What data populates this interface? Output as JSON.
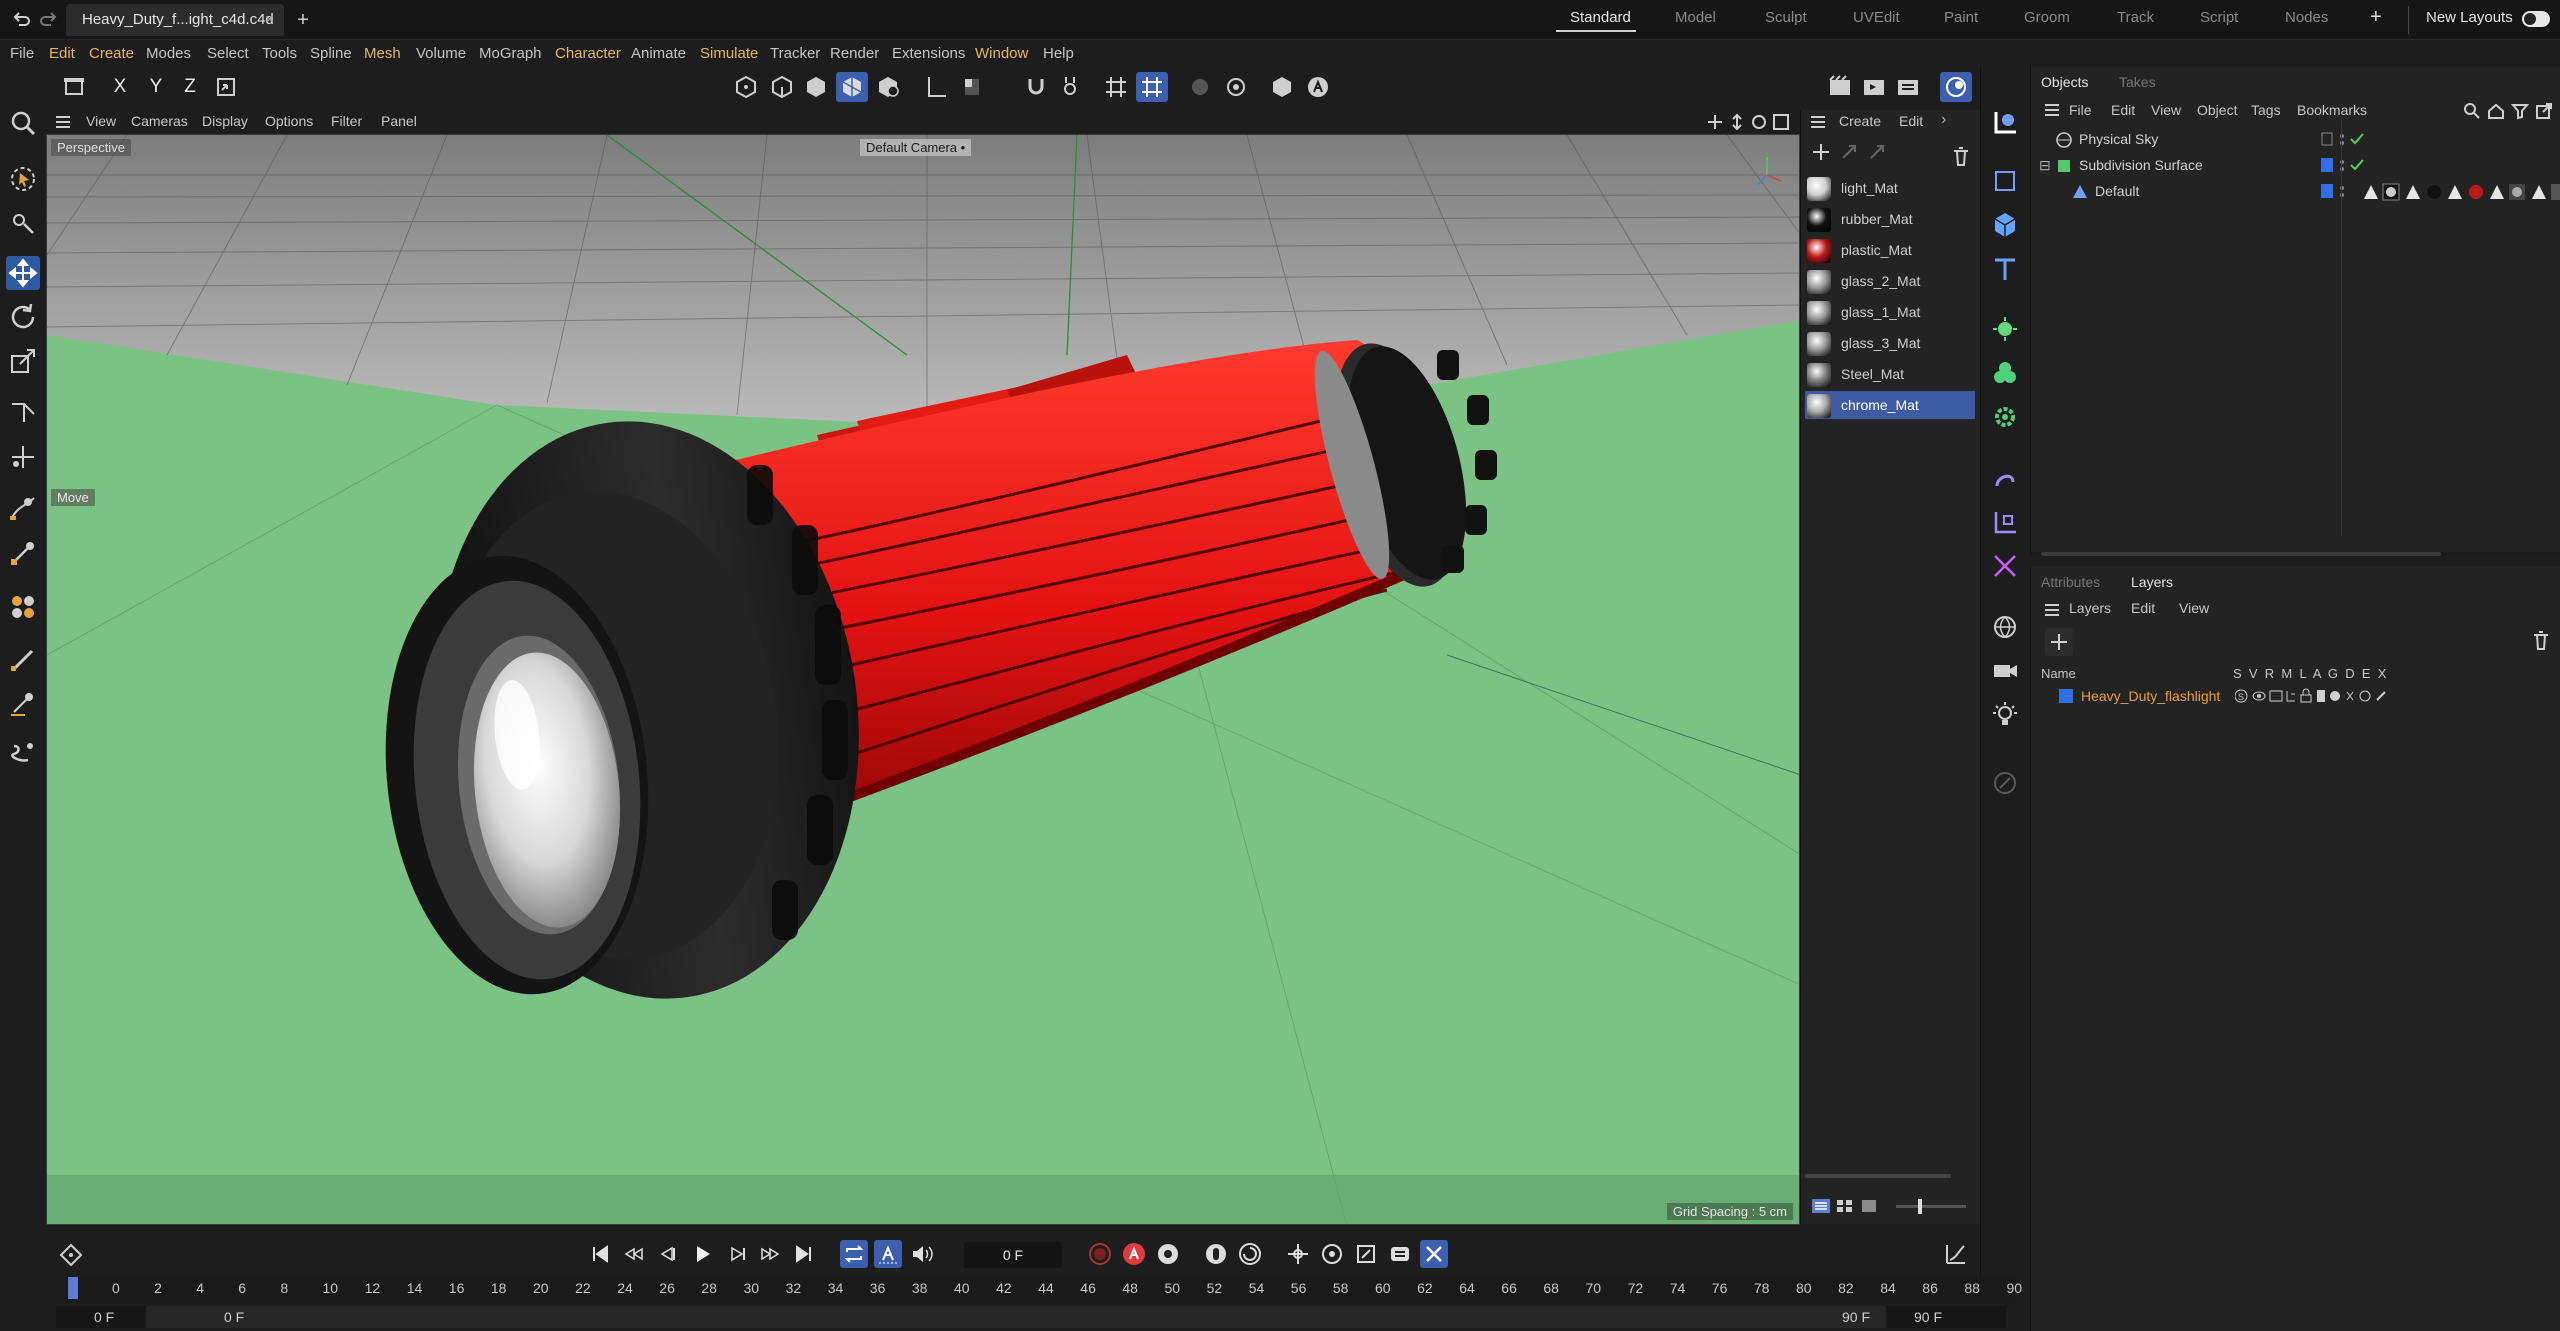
{
  "titlebar": {
    "file_tab": "Heavy_Duty_f...ight_c4d.c4d",
    "close": "×",
    "add_tab": "+",
    "layouts": [
      "Standard",
      "Model",
      "Sculpt",
      "UVEdit",
      "Paint",
      "Groom",
      "Track",
      "Script",
      "Nodes"
    ],
    "active_layout": "Standard",
    "plus": "+",
    "new_layouts": "New Layouts"
  },
  "menubar": [
    "File",
    "Edit",
    "Create",
    "Modes",
    "Select",
    "Tools",
    "Spline",
    "Mesh",
    "Volume",
    "MoGraph",
    "Character",
    "Animate",
    "Simulate",
    "Tracker",
    "Render",
    "Extensions",
    "Window",
    "Help"
  ],
  "axis_buttons": {
    "x": "X",
    "y": "Y",
    "z": "Z"
  },
  "viewport": {
    "menus": [
      "View",
      "Cameras",
      "Display",
      "Options",
      "Filter",
      "Panel"
    ],
    "projection": "Perspective",
    "camera": "Default Camera",
    "camera_suffix": "•",
    "tool_hint": "Move",
    "grid_spacing": "Grid Spacing : 5 cm"
  },
  "materials": {
    "menus": [
      "Create",
      "Edit"
    ],
    "items": [
      {
        "name": "light_Mat",
        "color": "#cfcfcf"
      },
      {
        "name": "rubber_Mat",
        "color": "#111111"
      },
      {
        "name": "plastic_Mat",
        "color": "#c01818"
      },
      {
        "name": "glass_2_Mat",
        "color": "#9a9a9a"
      },
      {
        "name": "glass_1_Mat",
        "color": "#9a9a9a"
      },
      {
        "name": "glass_3_Mat",
        "color": "#9a9a9a"
      },
      {
        "name": "Steel_Mat",
        "color": "#808080"
      },
      {
        "name": "chrome_Mat",
        "color": "#aaaaaa"
      }
    ],
    "selected": "chrome_Mat"
  },
  "objects": {
    "tabs": [
      "Objects",
      "Takes"
    ],
    "menus": [
      "File",
      "Edit",
      "View",
      "Object",
      "Tags",
      "Bookmarks"
    ],
    "rows": [
      "Physical Sky",
      "Subdivision Surface",
      "Default"
    ]
  },
  "layers": {
    "tabs": [
      "Attributes",
      "Layers"
    ],
    "menus": [
      "Layers",
      "Edit",
      "View"
    ],
    "col_name": "Name",
    "col_flags": "S  V  R  M  L  A  G  D  E  X",
    "layer_name": "Heavy_Duty_flashlight",
    "layer_color": "#2f6fe0"
  },
  "timeline": {
    "current_frame": "0 F",
    "ticks": [
      "0",
      "2",
      "4",
      "6",
      "8",
      "10",
      "12",
      "14",
      "16",
      "18",
      "20",
      "22",
      "24",
      "26",
      "28",
      "30",
      "32",
      "34",
      "36",
      "38",
      "40",
      "42",
      "44",
      "46",
      "48",
      "50",
      "52",
      "54",
      "56",
      "58",
      "60",
      "62",
      "64",
      "66",
      "68",
      "70",
      "72",
      "74",
      "76",
      "78",
      "80",
      "82",
      "84",
      "86",
      "88",
      "90"
    ],
    "start_field": "0 F",
    "start_field2": "0 F",
    "end_field": "90 F",
    "end_field2": "90 F"
  },
  "colors": {
    "accent": "#3d5ba4",
    "floor": "#7ac384",
    "flashlight_body": "#e11616",
    "rubber": "#1c1c1c"
  }
}
